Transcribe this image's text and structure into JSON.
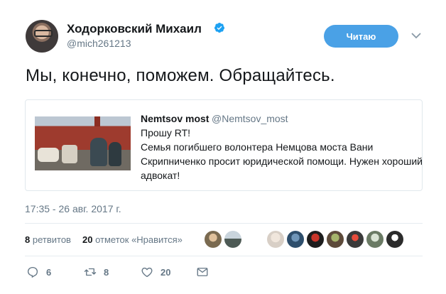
{
  "author": {
    "name": "Ходорковский Михаил",
    "handle": "@mich261213"
  },
  "follow_button": "Читаю",
  "tweet_text": "Мы, конечно, поможем. Обращайтесь.",
  "quote": {
    "name": "Nemtsov most",
    "handle": "@Nemtsov_most",
    "lines": [
      "Прошу RT!",
      "Семья погибшего волонтера Немцова моста Вани",
      "Скрипниченко просит юридической помощи. Нужен хороший",
      "адвокат!"
    ]
  },
  "timestamp": "17:35 - 26 авг. 2017 г.",
  "stats": {
    "retweets_count": "8",
    "retweets_label": "ретвитов",
    "likes_count": "20",
    "likes_label": "отметок «Нравится»"
  },
  "actions": {
    "reply_count": "6",
    "retweet_count": "8",
    "like_count": "20"
  },
  "icons": [
    "verified-icon",
    "chevron-down-icon",
    "reply-icon",
    "retweet-icon",
    "heart-icon",
    "message-icon"
  ],
  "colors": {
    "accent": "#1da1f2",
    "follow_bg": "#4aa1e6",
    "secondary_text": "#657786",
    "border": "#e1e8ed"
  }
}
